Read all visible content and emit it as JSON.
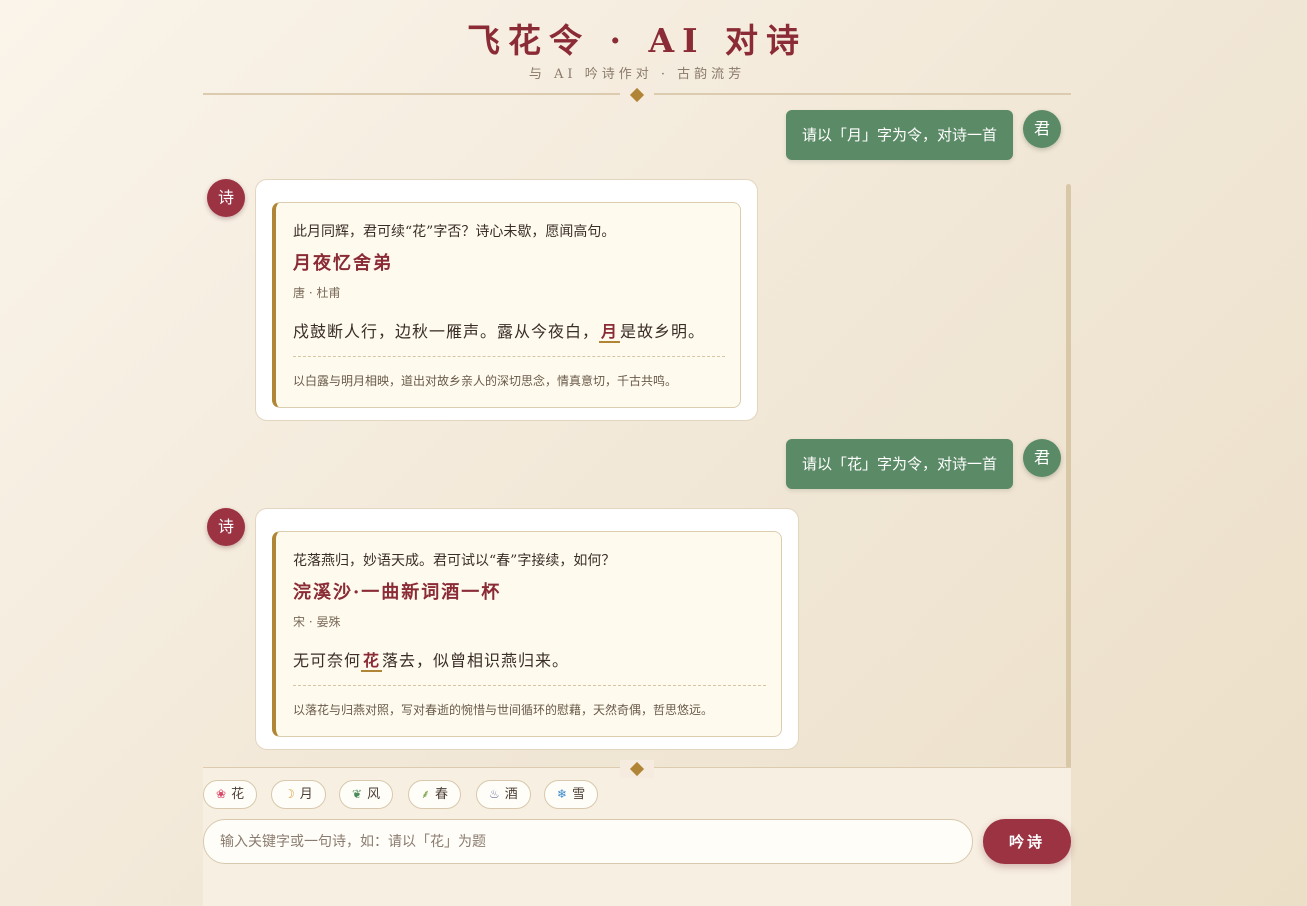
{
  "header": {
    "title": "飞花令 · AI 对诗",
    "subtitle": "与 AI 吟诗作对 · 古韵流芳"
  },
  "messages": [
    {
      "role": "user",
      "avatar": "君",
      "text": "请以「月」字为令，对诗一首"
    },
    {
      "role": "ai",
      "avatar": "诗",
      "intro": "此月同辉，君可续“花”字否？诗心未歇，愿闻高句。",
      "poem_title": "月夜忆舍弟",
      "author": "唐 · 杜甫",
      "line_before": "戍鼓断人行，边秋一雁声。露从今夜白，",
      "keyword": "月",
      "line_after": "是故乡明。",
      "comment": "以白露与明月相映，道出对故乡亲人的深切思念，情真意切，千古共鸣。"
    },
    {
      "role": "user",
      "avatar": "君",
      "text": "请以「花」字为令，对诗一首"
    },
    {
      "role": "ai",
      "avatar": "诗",
      "intro": "花落燕归，妙语天成。君可试以“春”字接续，如何？",
      "poem_title": "浣溪沙·一曲新词酒一杯",
      "author": "宋 · 晏殊",
      "line_before": "无可奈何",
      "keyword": "花",
      "line_after": "落去，似曾相识燕归来。",
      "comment": "以落花与归燕对照，写对春逝的惋惜与世间循环的慰藉，天然奇偶，哲思悠远。"
    }
  ],
  "chips": [
    {
      "icon": "flower-icon",
      "glyph": "❀",
      "color": "#d94a6a",
      "label": "花"
    },
    {
      "icon": "moon-icon",
      "glyph": "☽",
      "color": "#d89a30",
      "label": "月"
    },
    {
      "icon": "leaf-icon",
      "glyph": "❦",
      "color": "#4a8a5a",
      "label": "风"
    },
    {
      "icon": "sprout-icon",
      "glyph": "⸙",
      "color": "#6a9a3a",
      "label": "春"
    },
    {
      "icon": "wine-icon",
      "glyph": "♨",
      "color": "#6a6aa0",
      "label": "酒"
    },
    {
      "icon": "snowflake-icon",
      "glyph": "❄",
      "color": "#3a8ad0",
      "label": "雪"
    }
  ],
  "input": {
    "placeholder": "输入关键字或一句诗，如：请以「花」为题",
    "value": ""
  },
  "send_label": "吟诗"
}
